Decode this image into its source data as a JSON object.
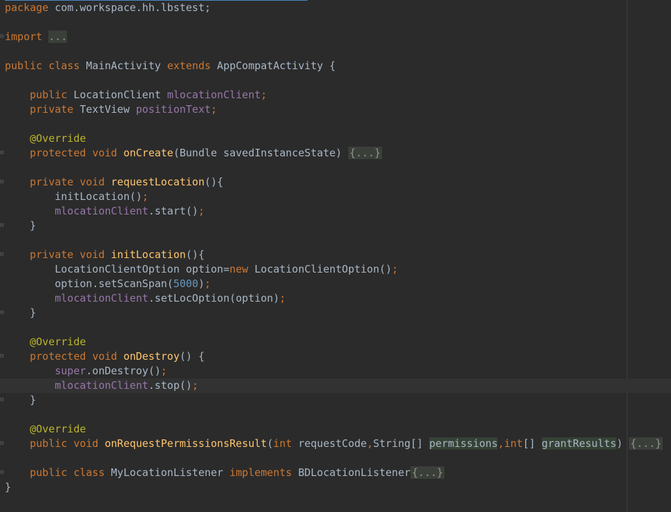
{
  "lines": {
    "l1": {
      "kw1": "package",
      "rest": " com.workspace.hh.lbstest;"
    },
    "l2": {
      "kw1": "import",
      "sp": " ",
      "fold": "..."
    },
    "l3": {
      "kw1": "public",
      "sp1": " ",
      "kw2": "class",
      "mid": " MainActivity ",
      "kw3": "extends",
      "rest": " AppCompatActivity {"
    },
    "l4": {
      "indent": "    ",
      "kw1": "public",
      "type": " LocationClient ",
      "fld": "mlocationClient",
      "semi": ";"
    },
    "l5": {
      "indent": "    ",
      "kw1": "private",
      "type": " TextView ",
      "fld": "positionText",
      "semi": ";"
    },
    "l6": {
      "indent": "    ",
      "ann": "@Override"
    },
    "l7": {
      "indent": "    ",
      "kw1": "protected",
      "sp": " ",
      "kw2": "void",
      "sp2": " ",
      "fn": "onCreate",
      "rest": "(Bundle savedInstanceState) ",
      "fold": "{...}"
    },
    "l8": {
      "indent": "    ",
      "kw1": "private",
      "sp": " ",
      "kw2": "void",
      "sp2": " ",
      "fn": "requestLocation",
      "rest": "(){"
    },
    "l9": {
      "indent": "        ",
      "call": "initLocation()",
      "semi": ";"
    },
    "l10": {
      "indent": "        ",
      "fld": "mlocationClient",
      "call": ".start()",
      "semi": ";"
    },
    "l11": {
      "indent": "    ",
      "brace": "}"
    },
    "l12": {
      "indent": "    ",
      "kw1": "private",
      "sp": " ",
      "kw2": "void",
      "sp2": " ",
      "fn": "initLocation",
      "rest": "(){"
    },
    "l13": {
      "indent": "        ",
      "pre": "LocationClientOption option=",
      "kw": "new",
      "post": " LocationClientOption()",
      "semi": ";"
    },
    "l14": {
      "indent": "        ",
      "pre": "option.setScanSpan(",
      "num": "5000",
      "post": ")",
      "semi": ";"
    },
    "l15": {
      "indent": "        ",
      "fld": "mlocationClient",
      "call": ".setLocOption(option)",
      "semi": ";"
    },
    "l16": {
      "indent": "    ",
      "brace": "}"
    },
    "l17": {
      "indent": "    ",
      "ann": "@Override"
    },
    "l18": {
      "indent": "    ",
      "kw1": "protected",
      "sp": " ",
      "kw2": "void",
      "sp2": " ",
      "fn": "onDestroy",
      "rest": "() {"
    },
    "l19": {
      "indent": "        ",
      "kw": "super",
      "call": ".onDestroy()",
      "semi": ";"
    },
    "l20": {
      "indent": "        ",
      "fld": "mlocationClient",
      "call": ".stop()",
      "semi": ";"
    },
    "l21": {
      "indent": "    ",
      "brace": "}"
    },
    "l22": {
      "indent": "    ",
      "ann": "@Override"
    },
    "l23": {
      "indent": "    ",
      "kw1": "public",
      "sp": " ",
      "kw2": "void",
      "sp2": " ",
      "fn": "onRequestPermissionsResult",
      "p1": "(",
      "int1": "int",
      "p2": " requestCode",
      "c1": ",",
      "p3": "String[] ",
      "perm": "permissions",
      "c2": ",",
      "int2": "int",
      "p4": "[] ",
      "grant": "grantResults",
      "p5": ") ",
      "fold": "{...}"
    },
    "l24": {
      "indent": "    ",
      "kw1": "public",
      "sp": " ",
      "kw2": "class",
      "mid": " MyLocationListener ",
      "kw3": "implements",
      "rest": " BDLocationListener",
      "fold": "{...}"
    },
    "l25": {
      "brace": "}"
    }
  },
  "colors": {
    "background": "#2b2b2b",
    "keyword": "#cc7832",
    "function": "#ffc66d",
    "field": "#9876aa",
    "annotation": "#bbb529",
    "number": "#6897bb",
    "plain": "#a9b7c6",
    "current_line": "#323232"
  },
  "icons": {
    "fold_open": "fold-open-icon",
    "fold_closed": "fold-closed-icon"
  }
}
